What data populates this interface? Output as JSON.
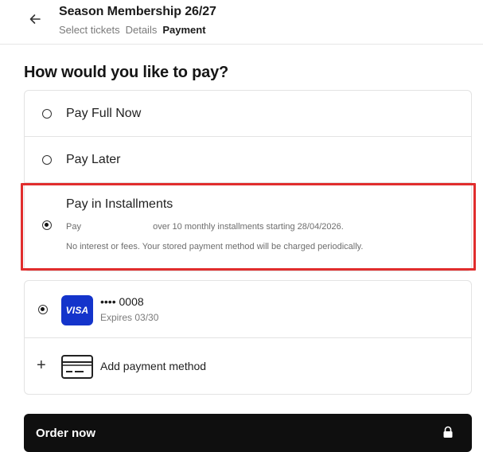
{
  "header": {
    "back_icon": "arrow-left-icon",
    "title": "Season Membership 26/27",
    "breadcrumbs": [
      "Select tickets",
      "Details",
      "Payment"
    ],
    "active_step": "Payment"
  },
  "payment_question": "How would you like to pay?",
  "payment_options": [
    {
      "label": "Pay Full Now",
      "selected": false
    },
    {
      "label": "Pay Later",
      "selected": false
    },
    {
      "label": "Pay in Installments",
      "selected": true,
      "detail_prefix": "Pay",
      "detail_suffix": "over 10 monthly installments starting 28/04/2026.",
      "note": "No interest or fees. Your stored payment method will be charged periodically."
    }
  ],
  "highlight_color": "#e12d2d",
  "saved_card": {
    "brand": "VISA",
    "brand_color": "#1434cb",
    "masked_number": "•••• 0008",
    "expiry": "Expires 03/30",
    "selected": true
  },
  "add_payment": {
    "plus_icon": "plus-icon",
    "card_icon": "credit-card-icon",
    "label": "Add payment method"
  },
  "order_button": {
    "label": "Order now",
    "icon": "lock-icon",
    "bg_color": "#0f0f0f"
  }
}
